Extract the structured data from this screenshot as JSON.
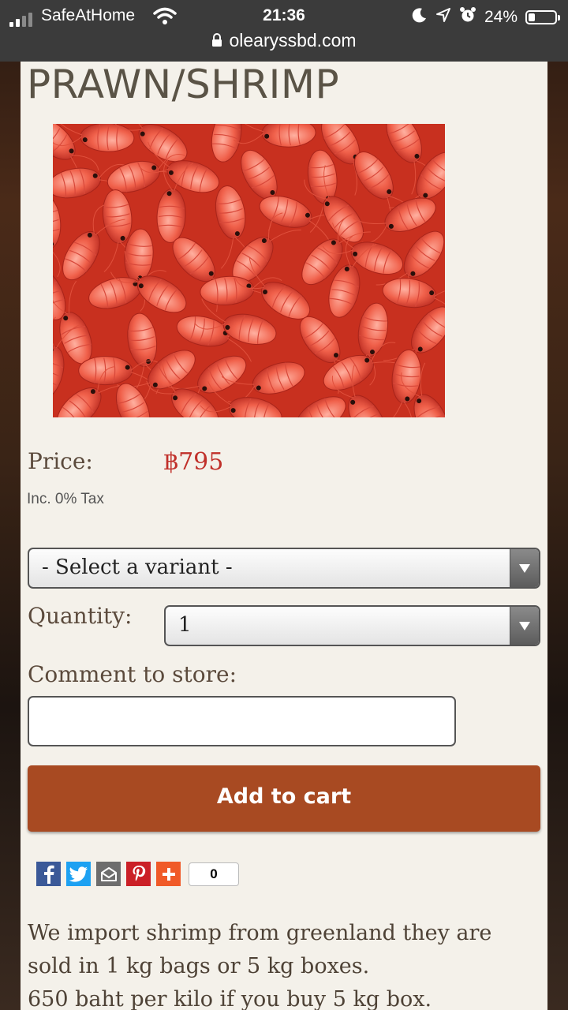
{
  "status_bar": {
    "carrier": "SafeAtHome",
    "time": "21:36",
    "battery_percent": "24%",
    "battery_level": 0.24
  },
  "browser": {
    "url": "olearyssbd.com"
  },
  "product": {
    "title": "PRAWN/SHRIMP",
    "price_label": "Price:",
    "price": "฿795",
    "tax_note": "Inc. 0% Tax",
    "variant_select_value": "- Select a variant -",
    "quantity_label": "Quantity:",
    "quantity_value": "1",
    "comment_label": "Comment to store:",
    "comment_value": "",
    "add_to_cart": "Add to cart",
    "share_count": "0",
    "description": [
      "We import shrimp from greenland they are sold in 1 kg bags or 5 kg boxes.",
      "650 baht per kilo if you buy 5 kg box."
    ]
  },
  "colors": {
    "accent_button": "#a84a22",
    "price": "#c0302a",
    "facebook": "#3b5998",
    "twitter": "#1da1f2",
    "pinterest": "#cb2027",
    "addthis": "#f05a28"
  },
  "icons": [
    "signal-icon",
    "wifi-icon",
    "moon-icon",
    "location-icon",
    "alarm-icon",
    "battery-icon",
    "lock-icon",
    "facebook-icon",
    "twitter-icon",
    "email-icon",
    "pinterest-icon",
    "plus-icon",
    "chevron-down-icon"
  ]
}
